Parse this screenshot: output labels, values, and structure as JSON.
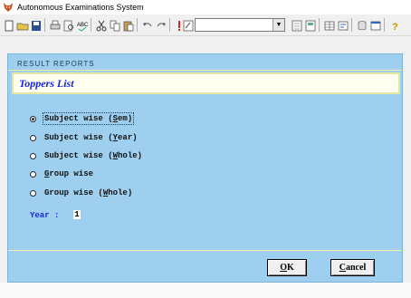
{
  "window": {
    "title": "Autonomous Examinations System",
    "icon": "fox-head-icon"
  },
  "toolbar": {
    "combo_value": "",
    "icons": [
      "new-icon",
      "open-icon",
      "save-icon",
      "print-icon",
      "print-preview-icon",
      "spell-check-icon",
      "cut-icon",
      "copy-icon",
      "paste-icon",
      "undo-icon",
      "redo-icon",
      "run-icon",
      "edit-icon",
      "form-icon",
      "report-icon",
      "table-icon",
      "query-icon",
      "database-icon",
      "window-icon",
      "help-icon"
    ]
  },
  "dialog": {
    "section_caption": "RESULT REPORTS",
    "header_title": "Toppers List",
    "options": [
      {
        "pre": "Subject wise (",
        "key": "S",
        "post": "em)",
        "checked": true
      },
      {
        "pre": "Subject wise (",
        "key": "Y",
        "post": "ear)",
        "checked": false
      },
      {
        "pre": "Subject wise (",
        "key": "W",
        "post": "hole)",
        "checked": false
      },
      {
        "pre": "",
        "key": "G",
        "post": "roup wise",
        "checked": false
      },
      {
        "pre": "Group wise (",
        "key": "W",
        "post": "hole)",
        "checked": false
      }
    ],
    "year_label": "Year :",
    "year_value": "1",
    "ok": {
      "key": "O",
      "rest": "K"
    },
    "cancel": {
      "key": "C",
      "rest": "ancel"
    }
  },
  "colors": {
    "dialog_bg": "#9ecfef",
    "header_bg": "#fffff0",
    "accent_text": "#1a25d9",
    "divider": "#f0f0a8"
  }
}
